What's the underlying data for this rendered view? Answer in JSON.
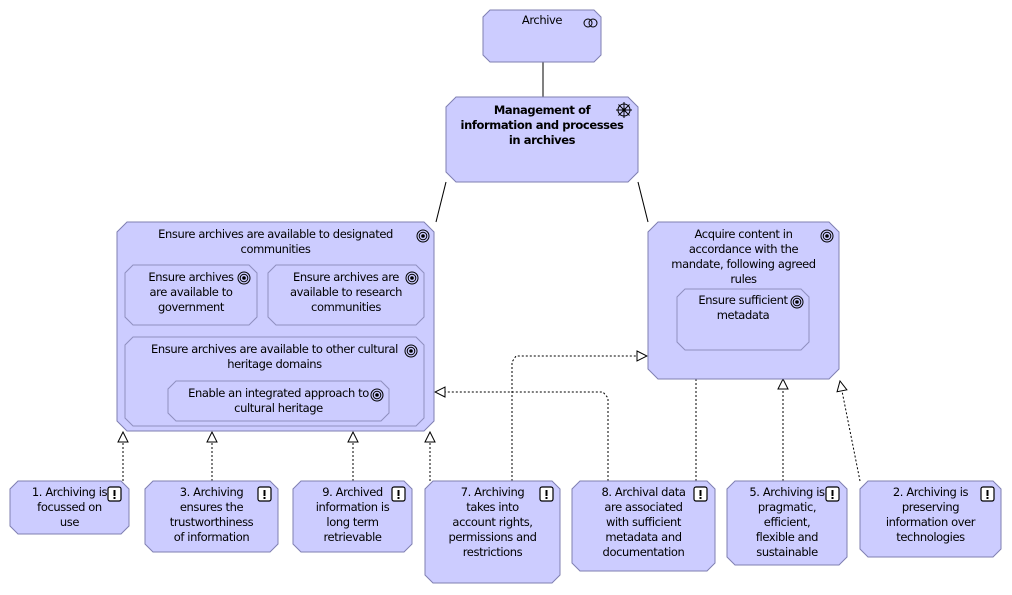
{
  "colors": {
    "fill": "#ccccff",
    "inner_fill": "#ccccff",
    "stroke": "#7f7fb2",
    "inner_stroke": "#8f8fbf",
    "line": "#000000"
  },
  "nodes": {
    "archive": {
      "label": "Archive",
      "icon": "collaboration-icon"
    },
    "management": {
      "label": "Management of information and processes in archives",
      "icon": "driver-icon"
    },
    "designated": {
      "label": "Ensure archives are available to designated communities",
      "icon": "goal-icon"
    },
    "government": {
      "label": "Ensure archives are available to government",
      "icon": "goal-icon"
    },
    "research": {
      "label": "Ensure archives are available to research communities",
      "icon": "goal-icon"
    },
    "cultural": {
      "label": "Ensure archives are available to other cultural heritage domains",
      "icon": "goal-icon"
    },
    "integrated": {
      "label": "Enable an integrated approach to cultural heritage",
      "icon": "goal-icon"
    },
    "acquire": {
      "label": "Acquire content in accordance with the mandate, following agreed rules",
      "icon": "goal-icon"
    },
    "metadata": {
      "label": "Ensure sufficient metadata",
      "icon": "goal-icon"
    },
    "p1": {
      "label": "1. Archiving is focussed on use",
      "icon": "principle-icon"
    },
    "p3": {
      "label": "3. Archiving ensures the trustworthiness of information",
      "icon": "principle-icon"
    },
    "p9": {
      "label": "9. Archived information is long term retrievable",
      "icon": "principle-icon"
    },
    "p7": {
      "label": "7. Archiving takes into account rights, permissions and restrictions",
      "icon": "principle-icon"
    },
    "p8": {
      "label": "8. Archival data are associated with sufficient metadata and documentation",
      "icon": "principle-icon"
    },
    "p5": {
      "label": "5. Archiving is pragmatic, efficient, flexible and sustainable",
      "icon": "principle-icon"
    },
    "p2": {
      "label": "2. Archiving is preserving information over technologies",
      "icon": "principle-icon"
    }
  },
  "label_lines": {
    "archive": [
      "Archive"
    ],
    "management": [
      "Management of",
      "information and processes",
      "in archives"
    ],
    "designated": [
      "Ensure archives are available to designated",
      "communities"
    ],
    "government": [
      "Ensure archives",
      "are available to",
      "government"
    ],
    "research": [
      "Ensure archives are",
      "available to research",
      "communities"
    ],
    "cultural": [
      "Ensure archives are available to other cultural",
      "heritage domains"
    ],
    "integrated": [
      "Enable an integrated approach to",
      "cultural heritage"
    ],
    "acquire": [
      "Acquire content in",
      "accordance with the",
      "mandate, following agreed",
      "rules"
    ],
    "metadata": [
      "Ensure sufficient",
      "metadata"
    ],
    "p1": [
      "1. Archiving is",
      "focussed on",
      "use"
    ],
    "p3": [
      "3. Archiving",
      "ensures the",
      "trustworthiness",
      "of information"
    ],
    "p9": [
      "9. Archived",
      "information is",
      "long term",
      "retrievable"
    ],
    "p7": [
      "7. Archiving",
      "takes into",
      "account rights,",
      "permissions and",
      "restrictions"
    ],
    "p8": [
      "8. Archival data",
      "are associated",
      "with sufficient",
      "metadata and",
      "documentation"
    ],
    "p5": [
      "5. Archiving is",
      "pragmatic,",
      "efficient,",
      "flexible and",
      "sustainable"
    ],
    "p2": [
      "2. Archiving is",
      "preserving",
      "information over",
      "technologies"
    ]
  },
  "relationships": [
    {
      "type": "association",
      "from": "archive",
      "to": "management"
    },
    {
      "type": "association",
      "from": "management",
      "to": "designated"
    },
    {
      "type": "association",
      "from": "management",
      "to": "acquire"
    },
    {
      "type": "realization",
      "from": "p1",
      "to": "designated"
    },
    {
      "type": "realization",
      "from": "p3",
      "to": "designated"
    },
    {
      "type": "realization",
      "from": "p9",
      "to": "designated"
    },
    {
      "type": "realization",
      "from": "p7",
      "to": "designated"
    },
    {
      "type": "realization",
      "from": "p7",
      "to": "acquire"
    },
    {
      "type": "realization",
      "from": "p8",
      "to": "designated"
    },
    {
      "type": "realization",
      "from": "p8",
      "to": "metadata"
    },
    {
      "type": "realization",
      "from": "p5",
      "to": "acquire"
    },
    {
      "type": "realization",
      "from": "p2",
      "to": "acquire"
    }
  ]
}
